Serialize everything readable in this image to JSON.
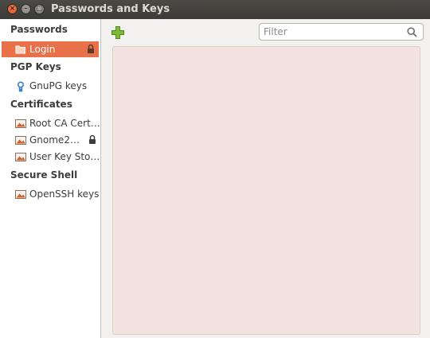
{
  "window": {
    "title": "Passwords and Keys"
  },
  "sidebar": {
    "sections": [
      {
        "title": "Passwords",
        "items": [
          {
            "label": "Login",
            "icon": "folder-icon",
            "locked": true,
            "selected": true
          }
        ]
      },
      {
        "title": "PGP Keys",
        "items": [
          {
            "label": "GnuPG keys",
            "icon": "key-icon",
            "locked": false
          }
        ]
      },
      {
        "title": "Certificates",
        "items": [
          {
            "label": "Root CA Cert…",
            "icon": "certificate-icon",
            "locked": false
          },
          {
            "label": "Gnome2…",
            "icon": "certificate-icon",
            "locked": true
          },
          {
            "label": "User Key Sto…",
            "icon": "certificate-icon",
            "locked": false
          }
        ]
      },
      {
        "title": "Secure Shell",
        "items": [
          {
            "label": "OpenSSH keys",
            "icon": "certificate-icon",
            "locked": false
          }
        ]
      }
    ]
  },
  "toolbar": {
    "add_icon": "plus-icon",
    "filter": {
      "placeholder": "Filter",
      "value": ""
    }
  },
  "colors": {
    "selection": "#e8714a",
    "titlebar": "#3c3b37",
    "pane": "#f3e3df"
  }
}
